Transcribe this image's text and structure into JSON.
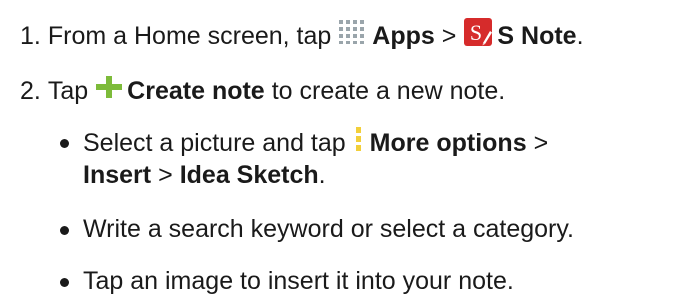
{
  "steps": [
    {
      "number": "1.",
      "prefix": "From a Home screen, tap",
      "apps_icon": "apps-grid-icon",
      "apps_label": "Apps",
      "sep": ">",
      "snote_icon": "s-note-app-icon",
      "snote_label": "S Note",
      "end": "."
    },
    {
      "number": "2.",
      "prefix": "Tap",
      "create_icon": "plus-icon",
      "create_label": "Create note",
      "suffix": "to create a new note."
    }
  ],
  "bullets": [
    {
      "prefix": "Select a picture and tap",
      "more_icon": "more-options-icon",
      "more_label": "More options",
      "sep1": ">",
      "insert_label": "Insert",
      "sep2": ">",
      "idea_label": "Idea Sketch",
      "end": "."
    },
    {
      "text": "Write a search keyword or select a category."
    },
    {
      "text": "Tap an image to insert it into your note."
    }
  ],
  "colors": {
    "text": "#1a1a1a",
    "icon_gray": "#8c9aa2",
    "plus_green": "#7dbb3a",
    "more_yellow": "#f2cf3a",
    "snote_red": "#d62b2b"
  }
}
